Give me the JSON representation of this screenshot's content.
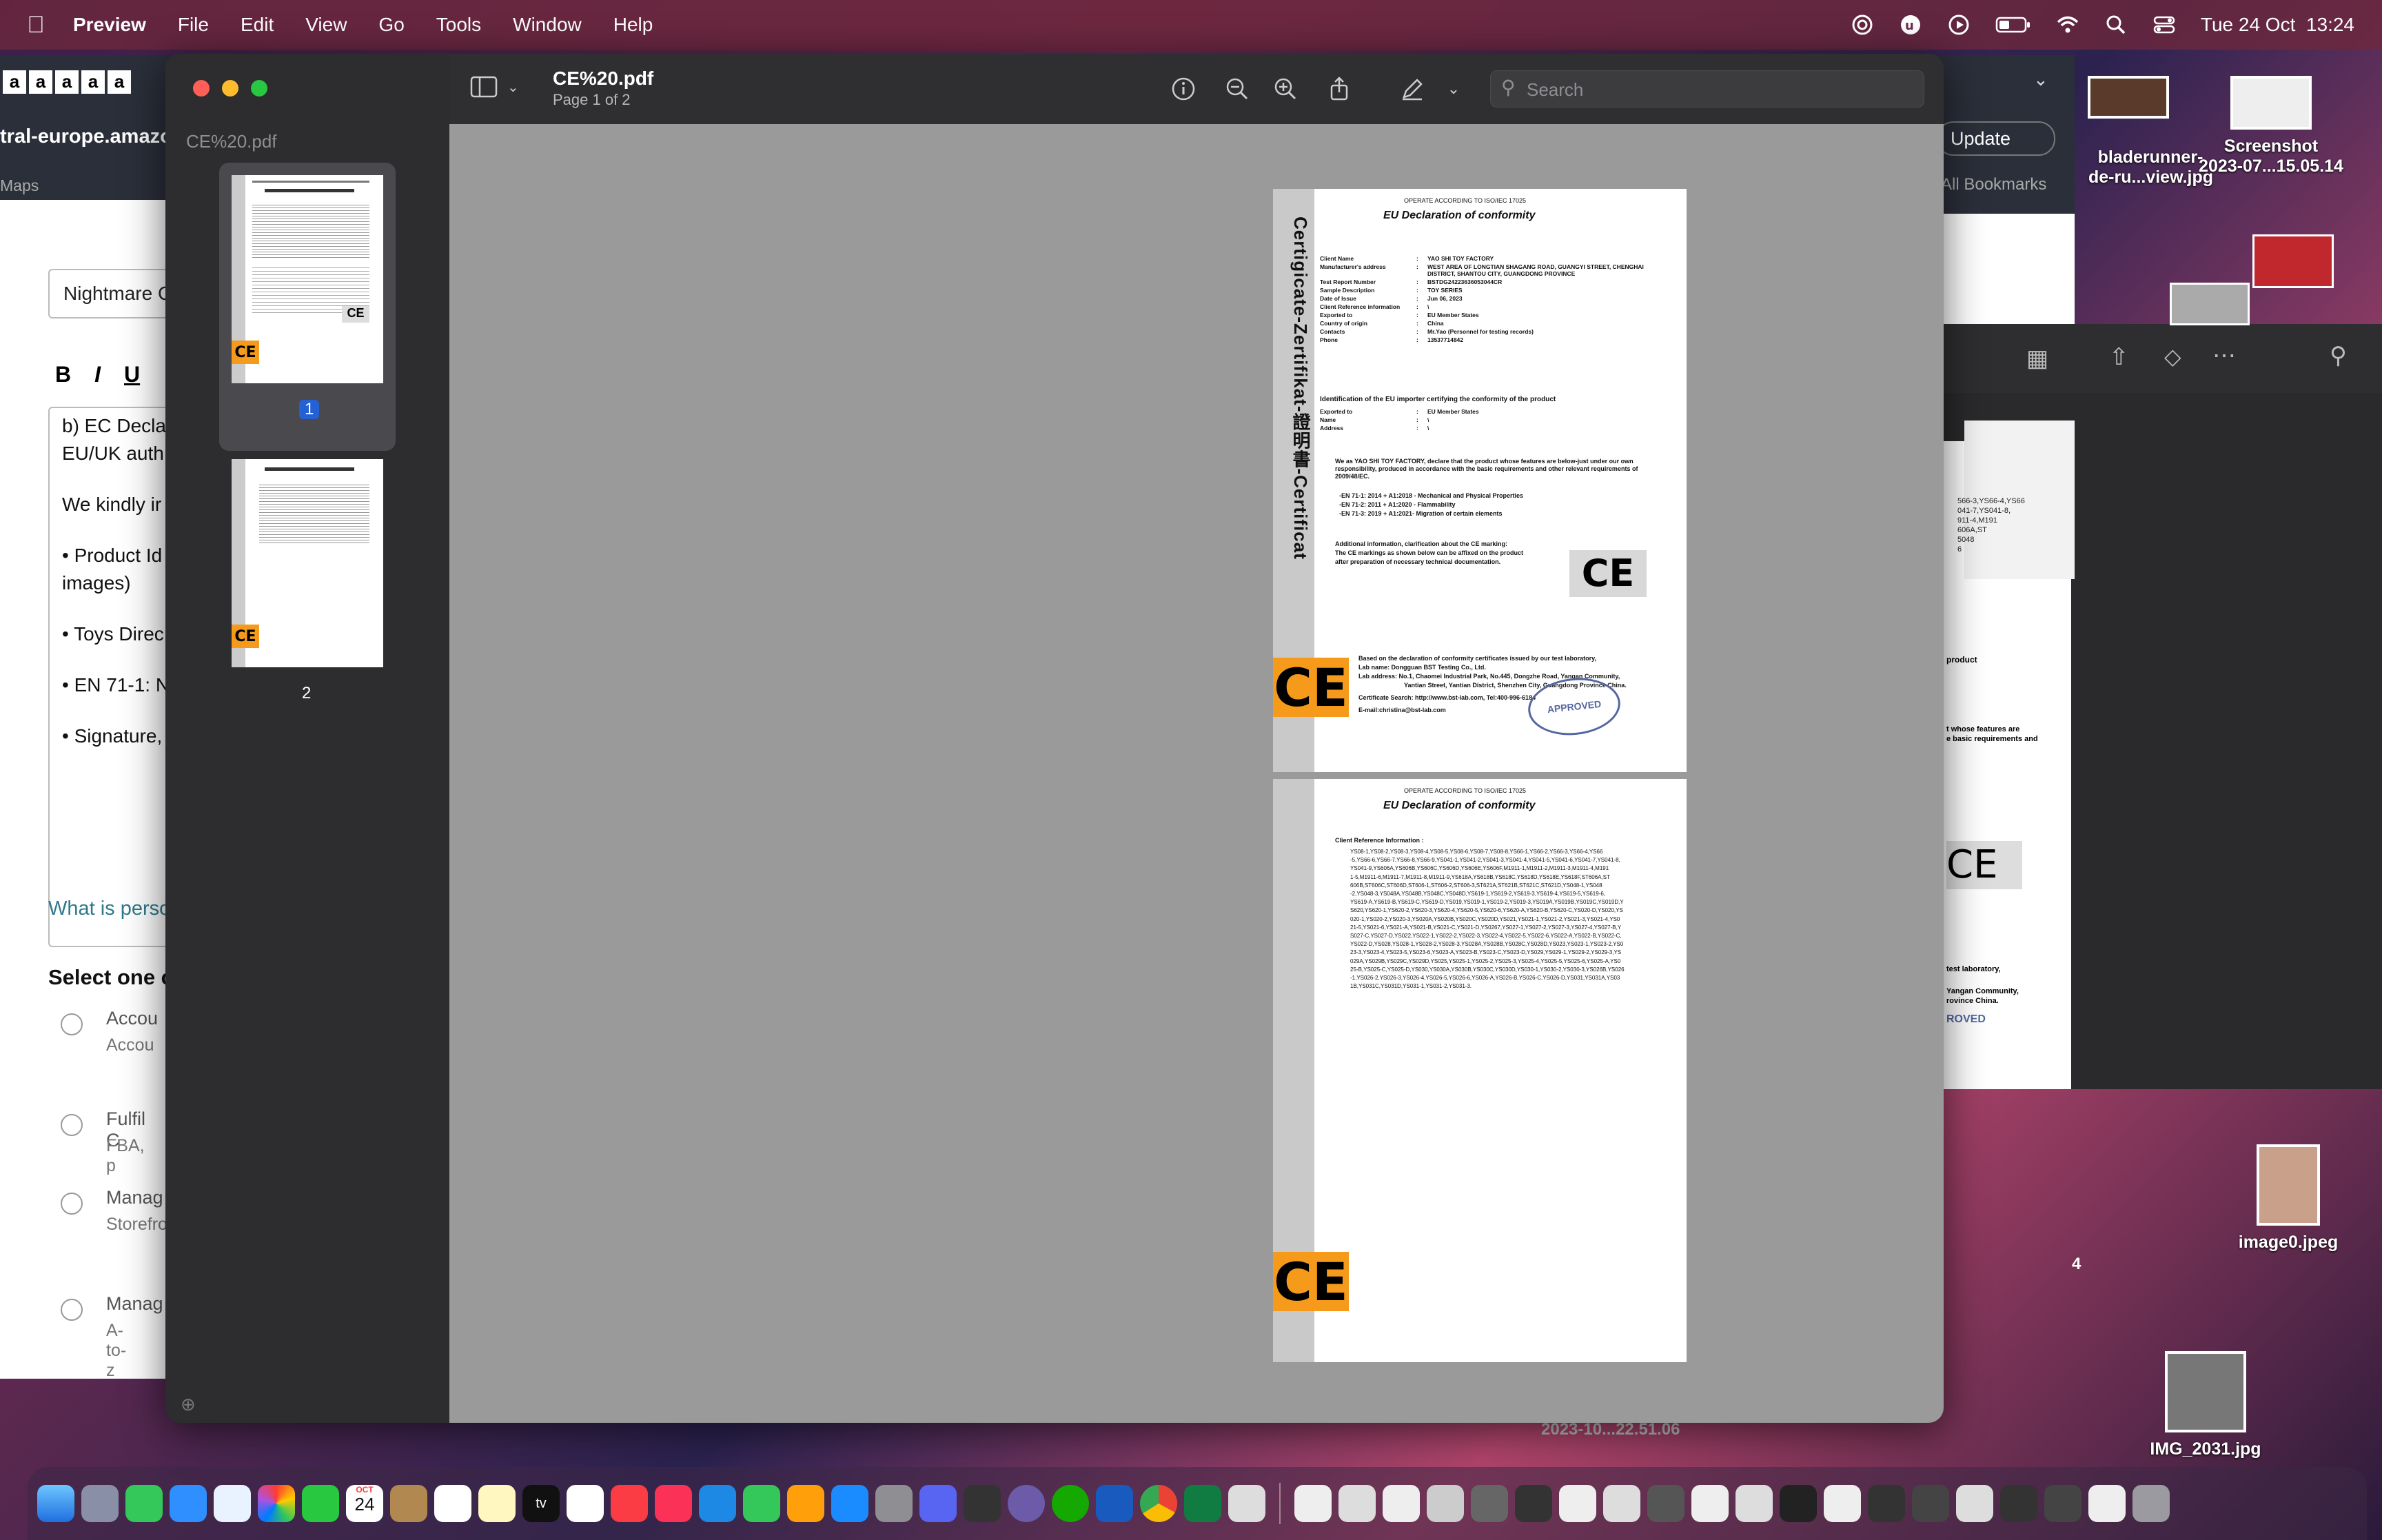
{
  "menubar": {
    "app_name": "Preview",
    "items": [
      "File",
      "Edit",
      "View",
      "Go",
      "Tools",
      "Window",
      "Help"
    ],
    "datetime": "Tue 24 Oct  13:24"
  },
  "background_app": {
    "url_fragment": "tral-europe.amazo",
    "tab_label": "Maps",
    "field_value": "Nightmare C",
    "editor_lines": [
      "b) EC Decla",
      "EU/UK auth",
      "We kindly ir",
      "• Product Id",
      "images)",
      "• Toys Direc",
      "• EN 71-1: N",
      "• Signature,"
    ],
    "link": "What is perso",
    "section_title": "Select one c",
    "options": [
      {
        "title": "Accou",
        "sub": "Accou"
      },
      {
        "title": "Fulfil C",
        "sub": "FBA, p"
      },
      {
        "title": "Manag",
        "sub": "Storefro"
      },
      {
        "title": "Manag",
        "sub": "A-to-z c"
      }
    ],
    "format_buttons": [
      "B",
      "I",
      "U"
    ]
  },
  "preview": {
    "sidebar_filename": "CE%20.pdf",
    "file_title": "CE%20.pdf",
    "page_info": "Page 1 of 2",
    "search_placeholder": "Search",
    "pages": [
      "1",
      "2"
    ]
  },
  "page1": {
    "header": "OPERATE ACCORDING TO ISO/IEC 17025",
    "title": "EU Declaration of conformity",
    "vertical": "Certigicate-Zertifikat-證明書-Certificat",
    "fields": [
      {
        "k": "Client Name",
        "v": "YAO SHI TOY FACTORY"
      },
      {
        "k": "Manufacturer's address",
        "v": "WEST AREA OF LONGTIAN SHAGANG ROAD, GUANGYI STREET, CHENGHAI DISTRICT, SHANTOU CITY, GUANGDONG PROVINCE"
      },
      {
        "k": "Test Report Number",
        "v": "BSTDG24223636053044CR"
      },
      {
        "k": "Sample Description",
        "v": "TOY SERIES"
      },
      {
        "k": "Date of Issue",
        "v": "Jun 06, 2023"
      },
      {
        "k": "Client Reference information",
        "v": "\\"
      },
      {
        "k": "Exported to",
        "v": "EU Member States"
      },
      {
        "k": "Country of origin",
        "v": "China"
      },
      {
        "k": "Contacts",
        "v": "Mr.Yao (Personnel for testing records)"
      },
      {
        "k": "Phone",
        "v": "13537714842"
      }
    ],
    "importer_title": "Identification of the EU importer certifying the conformity of the product",
    "importer": [
      {
        "k": "Exported to",
        "v": "EU Member States"
      },
      {
        "k": "Name",
        "v": "\\"
      },
      {
        "k": "Address",
        "v": "\\"
      }
    ],
    "declare": "We as  YAO SHI TOY FACTORY, declare that the product whose features are below-just under our own responsibility, produced in accordance with the basic requirements and other relevant requirements of 2009/48/EC.",
    "standards": [
      "-EN 71-1: 2014 + A1:2018 - Mechanical and Physical Properties",
      "-EN 71-2: 2011 + A1:2020 - Flammability",
      "-EN 71-3: 2019 + A1:2021- Migration of certain elements"
    ],
    "additional": [
      "Additional information, clarification about the CE marking:",
      "The CE markings as shown below can be affixed on the product",
      "after preparation of necessary technical documentation."
    ],
    "lab": [
      "Based on the declaration of conformity certificates issued by our test laboratory,",
      "Lab name: Dongguan BST Testing Co., Ltd.",
      "Lab address: No.1, Chaomei Industrial Park, No.445, Dongzhe Road, Yangan Community,",
      "Yantian Street, Yantian District, Shenzhen City, Guangdong Province China.",
      "Certificate Search: http://www.bst-lab.com,    Tel:400-996-6184",
      "E-mail:christina@bst-lab.com"
    ],
    "stamp": "APPROVED",
    "ce": "CE"
  },
  "page2": {
    "header": "OPERATE ACCORDING TO ISO/IEC 17025",
    "title": "EU Declaration of conformity",
    "ref_label": "Client Reference Information :",
    "ref_lines": [
      "YS08-1,YS08-2,YS08-3,YS08-4,YS08-5,YS08-6,YS08-7,YS08-8,YS66-1,YS66-2,YS66-3,YS66-4,YS66",
      "-5,YS66-6,YS66-7,YS66-8,YS66-9,YS041-1,YS041-2,YS041-3,YS041-4,YS041-5,YS041-6,YS041-7,YS041-8,",
      "YS041-9,YS606A,YS606B,YS606C,YS606D,YS606E,YS606F,M1911-1,M1911-2,M1911-3,M1911-4,M191",
      "1-5,M1911-6,M1911-7,M1911-8,M1911-9,YS618A,YS618B,YS618C,YS618D,YS618E,YS618F,ST606A,ST",
      "606B,ST606C,ST606D,ST606-1,ST606-2,ST606-3,ST621A,ST621B,ST621C,ST621D,YS048-1,YS048",
      "-2,YS048-3,YS048A,YS048B,YS048C,YS048D,YS619-1,YS619-2,YS619-3,YS619-4,YS619-5,YS619-6,",
      "YS619-A,YS619-B,YS619-C,YS619-D,YS019,YS019-1,YS019-2,YS019-3,YS019A,YS019B,YS019C,YS019D,Y",
      "S620,YS620-1,YS620-2,YS620-3,YS620-4,YS620-5,YS620-6,YS620-A,YS620-B,YS620-C,YS020-D,YS020,YS",
      "020-1,YS020-2,YS020-3,YS020A,YS020B,YS020C,YS020D,YS021,YS021-1,YS021-2,YS021-3,YS021-4,YS0",
      "21-5,YS021-6,YS021-A,YS021-B,YS021-C,YS021-D,YS0267,YS027-1,YS027-2,YS027-3,YS027-4,YS027-B,Y",
      "S027-C,YS027-D,YS022,YS022-1,YS022-2,YS022-3,YS022-4,YS022-5,YS022-6,YS022-A,YS022-B,YS022-C,",
      "YS022-D,YS028,YS028-1,YS028-2,YS028-3,YS028A,YS028B,YS028C,YS028D,YS023,YS023-1,YS023-2,YS0",
      "23-3,YS023-4,YS023-5,YS023-6,YS023-A,YS023-B,YS023-C,YS023-D,YS029,YS029-1,YS029-2,YS029-3,YS",
      "029A,YS029B,YS029C,YS029D,YS025,YS025-1,YS025-2,YS025-3,YS025-4,YS025-5,YS025-6,YS025-A,YS0",
      "25-B,YS025-C,YS025-D,YS030,YS030A,YS030B,YS030C,YS030D,YS030-1,YS030-2,YS030-3,YS026B,YS026",
      "-1,YS026-2,YS026-3,YS026-4,YS026-5,YS026-6,YS026-A,YS026-B,YS026-C,YS026-D,YS031,YS031A,YS03",
      "1B,YS031C,YS031D,YS031-1,YS031-2,YS031-3."
    ],
    "ce": "CE"
  },
  "right_window": {
    "update_button": "Update",
    "bookmarks": "All Bookmarks",
    "fragments": [
      "566-3,YS66-4,YS66",
      "041-7,YS041-8,",
      "911-4,M191",
      "606A,ST",
      "5048",
      "6",
      "product",
      "t   whose   features are",
      "e basic requirements and",
      "test laboratory,",
      "Yangan Community,",
      "rovince China.",
      "ROVED"
    ]
  },
  "desktop": {
    "icons": [
      {
        "label": "bladerunner-\nde-ru...view.jpg"
      },
      {
        "label": "Screenshot\n2023-07...15.05.14"
      },
      {
        "label": "image0.jpeg"
      },
      {
        "label": "IMG_2031.jpg"
      }
    ],
    "bottom_text": "2023-10...22.51.06",
    "side_number": "4"
  },
  "dock": {
    "calendar_month": "OCT",
    "calendar_day": "24"
  },
  "colors": {
    "accent": "#2461d4",
    "ce_orange": "#f59a1b",
    "traffic_red": "#ff5f57",
    "traffic_yellow": "#febc2e",
    "traffic_green": "#28c840"
  }
}
